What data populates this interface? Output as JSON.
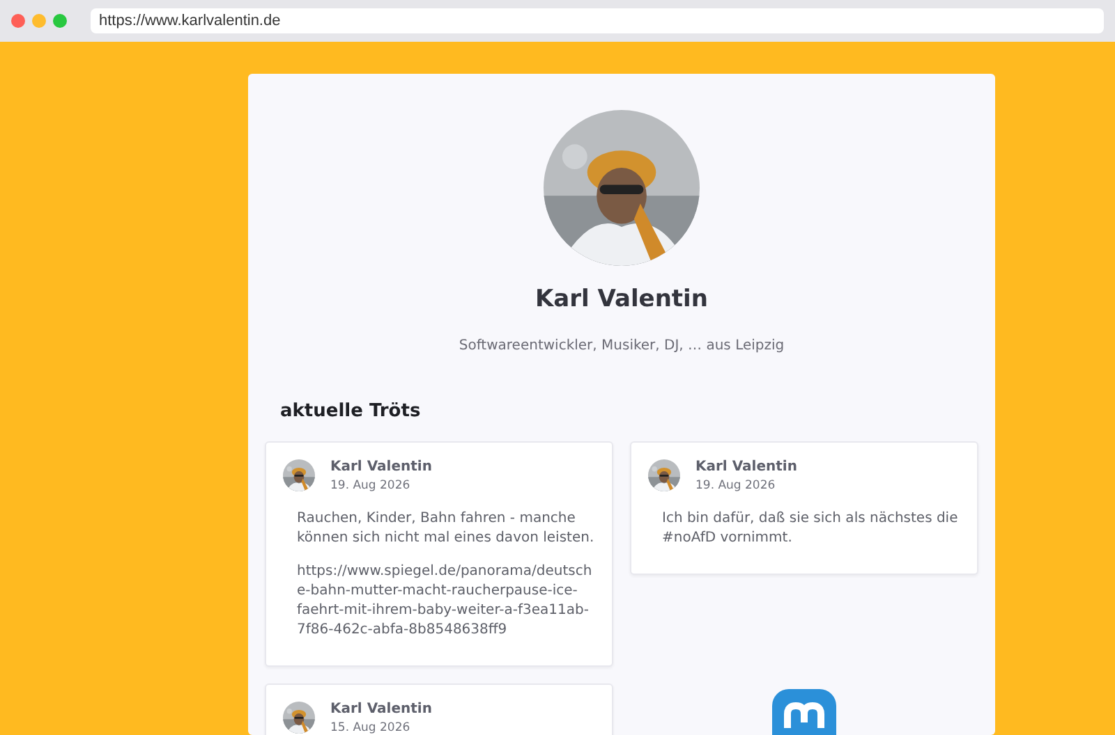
{
  "browser": {
    "url": "https://www.karlvalentin.de"
  },
  "profile": {
    "name": "Karl Valentin",
    "bio": "Softwareentwickler, Musiker, DJ, … aus Leipzig"
  },
  "section_title": "aktuelle Tröts",
  "posts": [
    {
      "author": "Karl Valentin",
      "date": "19. Aug 2026",
      "paragraphs": [
        "Rauchen, Kinder, Bahn fahren - manche können sich nicht mal eines davon leisten.",
        "https://www.spiegel.de/panorama/deutsche-bahn-mutter-macht-raucherpause-ice-faehrt-mit-ihrem-baby-weiter-a-f3ea11ab-7f86-462c-abfa-8b8548638ff9"
      ]
    },
    {
      "author": "Karl Valentin",
      "date": "19. Aug 2026",
      "paragraphs": [
        "Ich bin dafür, daß sie sich als nächstes die #noAfD vornimmt."
      ]
    },
    {
      "author": "Karl Valentin",
      "date": "15. Aug 2026"
    }
  ]
}
